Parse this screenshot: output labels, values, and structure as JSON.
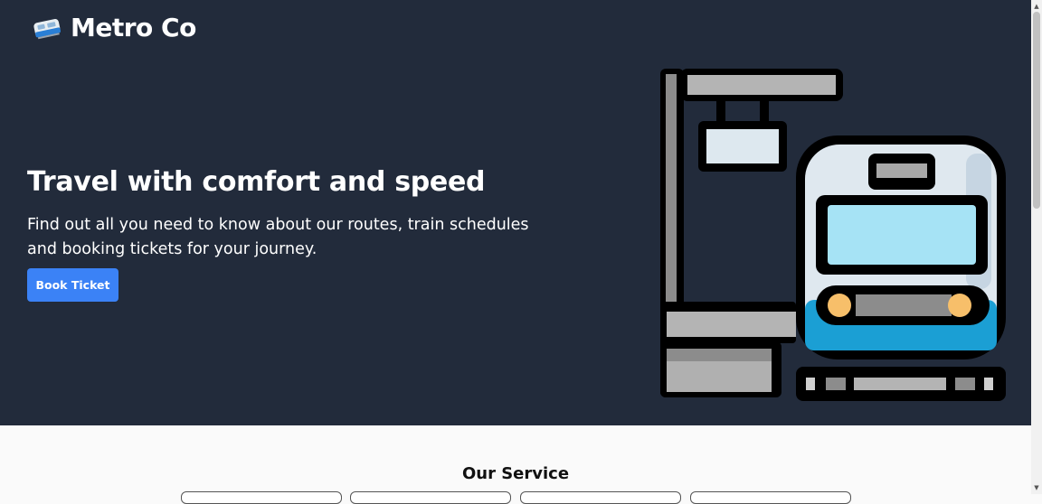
{
  "brand": {
    "name": "Metro Co",
    "icon": "train-icon"
  },
  "hero": {
    "headline": "Travel with comfort and speed",
    "subtext": "Find out all you need to know about our routes, train schedules and booking tickets for your journey.",
    "cta_label": "Book Ticket"
  },
  "services": {
    "title": "Our Service",
    "card_count": 4
  },
  "colors": {
    "hero_bg": "#222b3b",
    "accent": "#3b82f6",
    "train_window": "#a6e3f5",
    "train_stripe": "#1b9fd4",
    "headlight": "#f7bf6a"
  }
}
